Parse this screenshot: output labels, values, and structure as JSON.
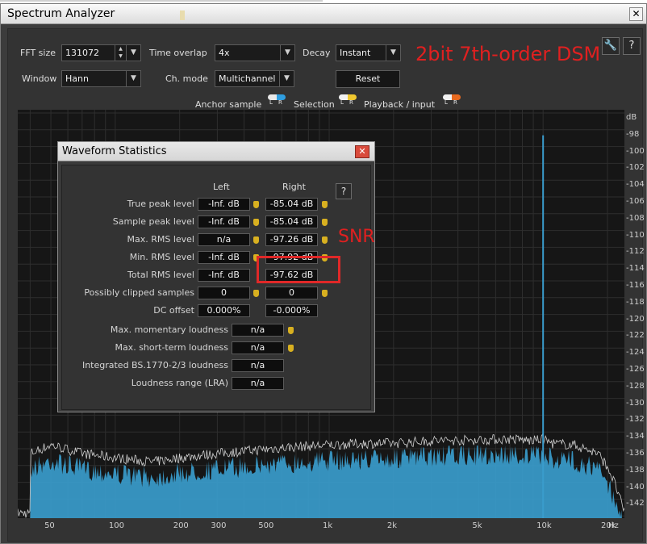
{
  "window": {
    "title": "Spectrum Analyzer",
    "close_glyph": "✕"
  },
  "controls": {
    "fft_size": {
      "label": "FFT size",
      "value": "131072"
    },
    "time_overlap": {
      "label": "Time overlap",
      "value": "4x"
    },
    "decay": {
      "label": "Decay",
      "value": "Instant"
    },
    "window_fn": {
      "label": "Window",
      "value": "Hann"
    },
    "ch_mode": {
      "label": "Ch. mode",
      "value": "Multichannel"
    },
    "reset_label": "Reset",
    "wrench_glyph": "🔧",
    "help_glyph": "?"
  },
  "annotation": {
    "title": "2bit 7th-order DSM",
    "snr_label": "SNR",
    "color": "#e02020"
  },
  "legend": {
    "anchor_sample": "Anchor sample",
    "selection": "Selection",
    "playback_input": "Playback / input",
    "l": "L",
    "r": "R"
  },
  "colors": {
    "spectrum_fill": "#3a9ccc",
    "spectrum_peak": "#ffffff",
    "plot_bg": "#161616",
    "grid": "#2e2e2e"
  },
  "chart_data": {
    "type": "area",
    "title": "",
    "xlabel": "Hz",
    "ylabel": "dB",
    "x_scale": "log",
    "xlim": [
      35,
      24000
    ],
    "ylim": [
      -144,
      -96
    ],
    "x_ticks": [
      "50",
      "100",
      "200",
      "300",
      "500",
      "1k",
      "2k",
      "5k",
      "10k",
      "20k",
      "Hz"
    ],
    "y_ticks": [
      "dB",
      "-98",
      "-100",
      "-102",
      "-104",
      "-106",
      "-108",
      "-110",
      "-112",
      "-114",
      "-116",
      "-118",
      "-120",
      "-122",
      "-124",
      "-126",
      "-128",
      "-130",
      "-132",
      "-134",
      "-136",
      "-138",
      "-140",
      "-142"
    ],
    "series": [
      {
        "x": [
          40,
          50,
          70,
          100,
          150,
          200,
          300,
          500,
          700,
          1000,
          1500,
          2000,
          3000,
          5000,
          7000,
          9000,
          10000,
          11000,
          14000,
          18000,
          20000,
          22000,
          24000
        ],
        "y": [
          -137,
          -136,
          -137,
          -137.5,
          -138,
          -137.5,
          -137,
          -136.5,
          -136.2,
          -136,
          -135.8,
          -135.8,
          -135.5,
          -135.4,
          -135.3,
          -135.5,
          -135.3,
          -135.8,
          -136,
          -137,
          -138.5,
          -141,
          -144
        ],
        "spike": {
          "x": 10000,
          "y": -99
        }
      }
    ]
  },
  "stats": {
    "title": "Waveform Statistics",
    "close_glyph": "✕",
    "help_glyph": "?",
    "col_left": "Left",
    "col_right": "Right",
    "rows": [
      {
        "label": "True peak level",
        "left": "-Inf. dB",
        "right": "-85.04 dB"
      },
      {
        "label": "Sample peak level",
        "left": "-Inf. dB",
        "right": "-85.04 dB"
      },
      {
        "label": "Max. RMS level",
        "left": "n/a",
        "right": "-97.26 dB"
      },
      {
        "label": "Min. RMS level",
        "left": "-Inf. dB",
        "right": "-97.92 dB"
      },
      {
        "label": "Total RMS level",
        "left": "-Inf. dB",
        "right": "-97.62 dB"
      },
      {
        "label": "Possibly clipped samples",
        "left": "0",
        "right": "0"
      },
      {
        "label": "DC offset",
        "left": "0.000%",
        "right": "-0.000%"
      }
    ],
    "loudness": [
      {
        "label": "Max. momentary loudness",
        "value": "n/a"
      },
      {
        "label": "Max. short-term loudness",
        "value": "n/a"
      },
      {
        "label": "Integrated BS.1770-2/3 loudness",
        "value": "n/a"
      },
      {
        "label": "Loudness range (LRA)",
        "value": "n/a"
      }
    ]
  }
}
